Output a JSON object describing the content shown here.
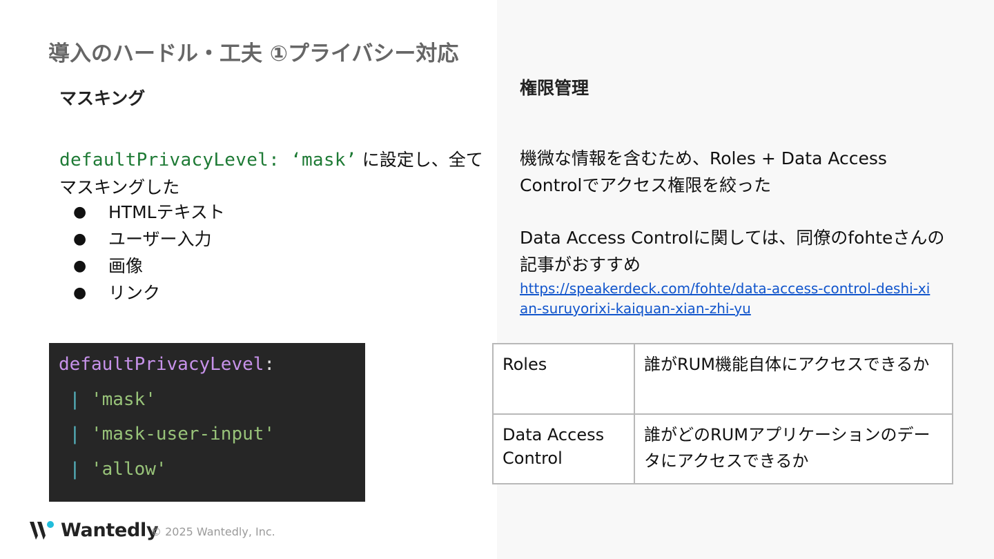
{
  "slide": {
    "title": "導入のハードル・工夫 ①プライバシー対応"
  },
  "left": {
    "heading": "マスキング",
    "description_code": "defaultPrivacyLevel: ‘mask’",
    "description_text": " に設定し、全てマスキングした",
    "bullets": [
      "HTMLテキスト",
      "ユーザー入力",
      "画像",
      "リンク"
    ],
    "bullet_symbol": "●",
    "code_block": {
      "key": "defaultPrivacyLevel",
      "colon": ":",
      "pipe": "|",
      "options": [
        "'mask'",
        "'mask-user-input'",
        "'allow'"
      ]
    }
  },
  "right": {
    "heading": "権限管理",
    "description": "機微な情報を含むため、Roles + Data Access Controlでアクセス権限を絞った",
    "note": "Data Access Controlに関しては、同僚のfohteさんの記事がおすすめ",
    "link": "https://speakerdeck.com/fohte/data-access-control-deshi-xian-suruyorixi-kaiquan-xian-zhi-yu",
    "table": {
      "rows": [
        {
          "name": "Roles",
          "desc": "誰がRUM機能自体にアクセスできるか"
        },
        {
          "name": "Data Access Control",
          "desc": "誰がどのRUMアプリケーションのデータにアクセスできるか"
        }
      ]
    }
  },
  "footer": {
    "brand": "Wantedly",
    "copyright": "© 2025 Wantedly, Inc."
  },
  "colors": {
    "right_panel_bg": "#f8f8f8",
    "code_bg": "#262626",
    "inline_code": "#1e7a35",
    "link": "#1155cc"
  }
}
